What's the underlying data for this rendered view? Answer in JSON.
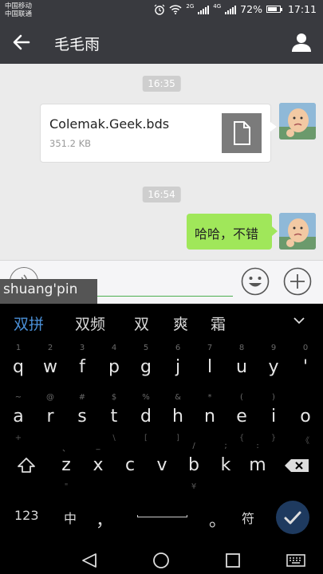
{
  "status_bar": {
    "carrier1": "中国移动",
    "carrier2": "中国联通",
    "net1": "2G",
    "net2": "4G",
    "battery": "72%",
    "time": "17:11"
  },
  "title_bar": {
    "title": "毛毛雨"
  },
  "chat": {
    "time1": "16:35",
    "file_name": "Colemak.Geek.bds",
    "file_size": "351.2 KB",
    "time2": "16:54",
    "message": "哈哈，不错"
  },
  "input": {
    "composing": "shuang'pin"
  },
  "keyboard": {
    "candidates": [
      "双拼",
      "双频",
      "双",
      "爽",
      "霜"
    ],
    "row1": [
      {
        "k": "q",
        "s": "1"
      },
      {
        "k": "w",
        "s": "2"
      },
      {
        "k": "f",
        "s": "3"
      },
      {
        "k": "p",
        "s": "4"
      },
      {
        "k": "g",
        "s": "5"
      },
      {
        "k": "j",
        "s": "6"
      },
      {
        "k": "l",
        "s": "7"
      },
      {
        "k": "u",
        "s": "8"
      },
      {
        "k": "y",
        "s": "9"
      },
      {
        "k": "'",
        "s": "0"
      }
    ],
    "row2": [
      {
        "k": "a",
        "s": "~"
      },
      {
        "k": "r",
        "s": "@"
      },
      {
        "k": "s",
        "s": "#"
      },
      {
        "k": "t",
        "s": "$"
      },
      {
        "k": "d",
        "s": "%"
      },
      {
        "k": "h",
        "s": "&"
      },
      {
        "k": "n",
        "s": "*"
      },
      {
        "k": "e",
        "s": "("
      },
      {
        "k": "i",
        "s": ")"
      },
      {
        "k": "o",
        "s": ""
      }
    ],
    "row2_sub2": [
      "+",
      "",
      "",
      "\\",
      "[",
      "]",
      "",
      "{",
      "}",
      "《"
    ],
    "row3": [
      {
        "k": "z",
        "s": "、"
      },
      {
        "k": "x",
        "s": "_"
      },
      {
        "k": "c",
        "s": ""
      },
      {
        "k": "v",
        "s": ""
      },
      {
        "k": "b",
        "s": "/"
      },
      {
        "k": "k",
        "s": ";"
      },
      {
        "k": "m",
        "s": ":"
      }
    ],
    "row3_sub2": [
      "\"",
      "",
      "",
      "",
      "¥",
      "",
      ""
    ],
    "num_label": "123",
    "lang_label": "中",
    "comma": "，",
    "period": "。",
    "sym_label": "符"
  }
}
